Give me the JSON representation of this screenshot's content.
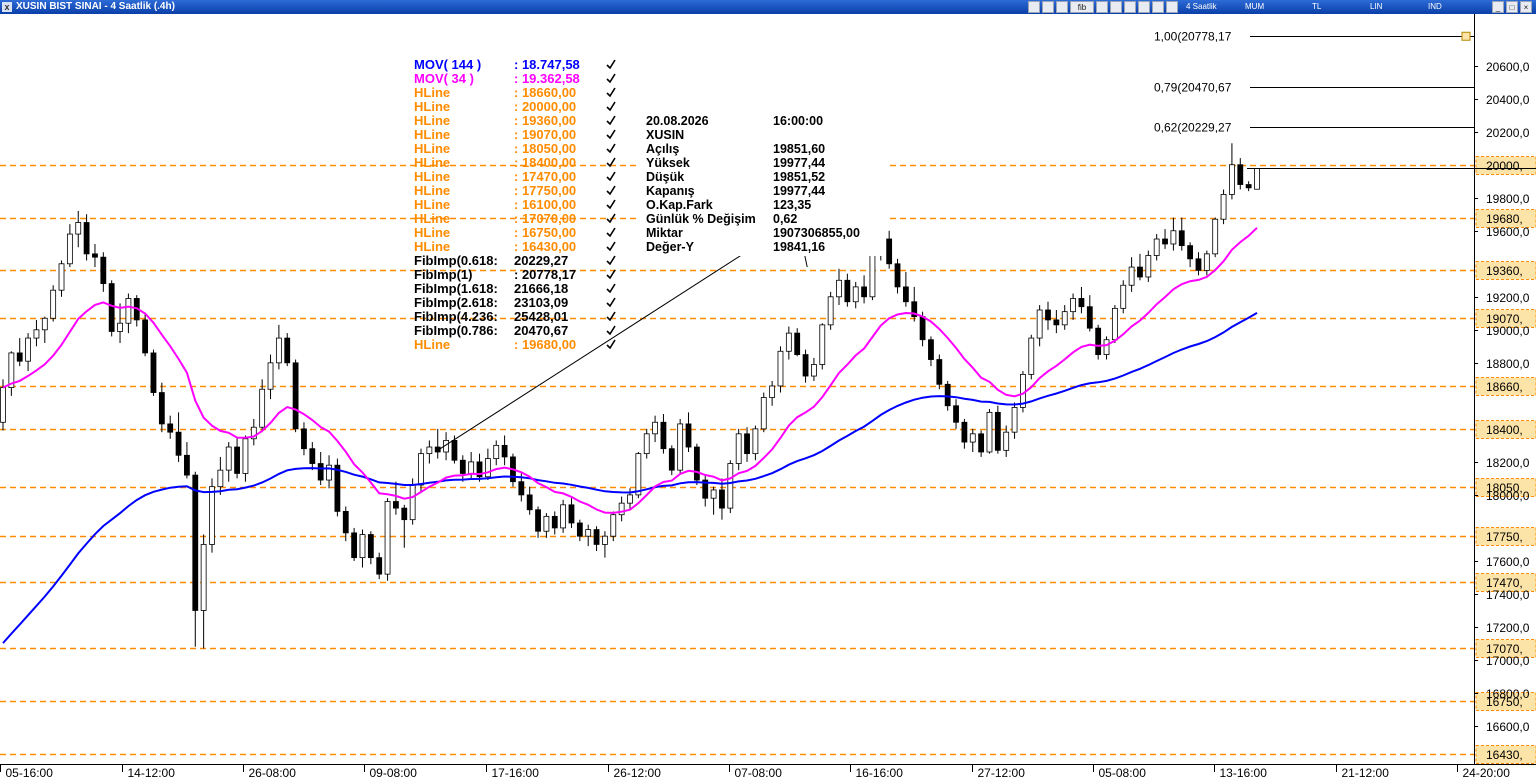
{
  "window": {
    "title": "XUSIN BIST SINAI - 4 Saatlik (.4h)",
    "toolbar": {
      "period": "4 Saatlik",
      "chart_style": "MUM",
      "currency": "TL",
      "scale": "LIN",
      "indicator": "IND",
      "fib_marker": "fib"
    }
  },
  "legend": [
    {
      "name": "MOV( 144 )",
      "value": ": 18.747,58",
      "color": "#0000ff"
    },
    {
      "name": "MOV( 34 )",
      "value": ": 19.362,58",
      "color": "#ff00ff"
    },
    {
      "name": "HLine",
      "value": ": 18660,00",
      "color": "#ff8c00"
    },
    {
      "name": "HLine",
      "value": ": 20000,00",
      "color": "#ff8c00"
    },
    {
      "name": "HLine",
      "value": ": 19360,00",
      "color": "#ff8c00"
    },
    {
      "name": "HLine",
      "value": ": 19070,00",
      "color": "#ff8c00"
    },
    {
      "name": "HLine",
      "value": ": 18050,00",
      "color": "#ff8c00"
    },
    {
      "name": "HLine",
      "value": ": 18400,00",
      "color": "#ff8c00"
    },
    {
      "name": "HLine",
      "value": ": 17470,00",
      "color": "#ff8c00"
    },
    {
      "name": "HLine",
      "value": ": 17750,00",
      "color": "#ff8c00"
    },
    {
      "name": "HLine",
      "value": ": 16100,00",
      "color": "#ff8c00"
    },
    {
      "name": "HLine",
      "value": ": 17070,00",
      "color": "#ff8c00"
    },
    {
      "name": "HLine",
      "value": ": 16750,00",
      "color": "#ff8c00"
    },
    {
      "name": "HLine",
      "value": ": 16430,00",
      "color": "#ff8c00"
    },
    {
      "name": "FibImp(0.618:",
      "value": " 20229,27",
      "color": "#000000"
    },
    {
      "name": "FibImp(1)",
      "value": ": 20778,17",
      "color": "#000000"
    },
    {
      "name": "FibImp(1.618:",
      "value": " 21666,18",
      "color": "#000000"
    },
    {
      "name": "FibImp(2.618:",
      "value": " 23103,09",
      "color": "#000000"
    },
    {
      "name": "FibImp(4.236:",
      "value": " 25428,01",
      "color": "#000000"
    },
    {
      "name": "FibImp(0.786:",
      "value": " 20470,67",
      "color": "#000000"
    },
    {
      "name": "HLine",
      "value": ": 19680,00",
      "color": "#ff8c00"
    }
  ],
  "info_panel": {
    "date": "20.08.2026",
    "time": "16:00:00",
    "symbol": "XUSIN",
    "rows": [
      {
        "label": "Açılış",
        "value": "19851,60"
      },
      {
        "label": "Yüksek",
        "value": "19977,44"
      },
      {
        "label": "Düşük",
        "value": "19851,52"
      },
      {
        "label": "Kapanış",
        "value": "19977,44"
      },
      {
        "label": "O.Kap.Fark",
        "value": "123,35"
      },
      {
        "label": "Günlük % Değişim",
        "value": "0,62"
      },
      {
        "label": "Miktar",
        "value": "1907306855,00"
      },
      {
        "label": "Değer-Y",
        "value": "19841,16"
      }
    ]
  },
  "colors": {
    "up_candle": "#ffffff",
    "down_candle": "#000000",
    "mov144": "#0000ff",
    "mov34": "#ff00ff",
    "hline": "#ff8c00",
    "price_badge": "#fce4a8"
  },
  "chart_data": {
    "type": "candlestick",
    "y_axis_ticks": [
      "20600,0",
      "20400,0",
      "20200,0",
      "19800,0",
      "19600,0",
      "19200,0",
      "19000,0",
      "18800,0",
      "18200,0",
      "18000,0",
      "17600,0",
      "17400,0",
      "17200,0",
      "17000,0",
      "16800,0",
      "16600,0"
    ],
    "y_axis_tick_values": [
      20600,
      20400,
      20200,
      19800,
      19600,
      19200,
      19000,
      18800,
      18200,
      18000,
      17600,
      17400,
      17200,
      17000,
      16800,
      16600
    ],
    "y_range": [
      16370,
      20913
    ],
    "x_axis_ticks": [
      "05-16:00",
      "14-12:00",
      "26-08:00",
      "09-08:00",
      "17-16:00",
      "26-12:00",
      "07-08:00",
      "16-16:00",
      "27-12:00",
      "05-08:00",
      "13-16:00",
      "21-12:00",
      "24-20:00"
    ],
    "hlines": [
      {
        "value": 20000,
        "label": "20000,"
      },
      {
        "value": 19680,
        "label": "19680,"
      },
      {
        "value": 19360,
        "label": "19360,"
      },
      {
        "value": 19070,
        "label": "19070,"
      },
      {
        "value": 18660,
        "label": "18660,"
      },
      {
        "value": 18400,
        "label": "18400,"
      },
      {
        "value": 18050,
        "label": "18050,"
      },
      {
        "value": 17750,
        "label": "17750,"
      },
      {
        "value": 17470,
        "label": "17470,"
      },
      {
        "value": 17070,
        "label": "17070,"
      },
      {
        "value": 16750,
        "label": "16750,"
      },
      {
        "value": 16430,
        "label": "16430,"
      }
    ],
    "fib_levels": [
      {
        "label": "1,00(20778,17",
        "value": 20778.17
      },
      {
        "label": "0,79(20470,67",
        "value": 20470.67
      },
      {
        "label": "0,62(20229,27",
        "value": 20229.27
      }
    ],
    "trendline": {
      "start": [
        52,
        18270
      ],
      "end": [
        95,
        19670
      ]
    },
    "last_close": 19977.44,
    "candles": [
      [
        18440,
        18700,
        18390,
        18650
      ],
      [
        18650,
        18870,
        18600,
        18860
      ],
      [
        18860,
        18950,
        18780,
        18810
      ],
      [
        18810,
        18980,
        18750,
        18950
      ],
      [
        18950,
        19060,
        18900,
        19000
      ],
      [
        19000,
        19080,
        18920,
        19070
      ],
      [
        19070,
        19270,
        19050,
        19240
      ],
      [
        19240,
        19420,
        19200,
        19400
      ],
      [
        19400,
        19640,
        19380,
        19580
      ],
      [
        19580,
        19720,
        19500,
        19650
      ],
      [
        19650,
        19700,
        19420,
        19460
      ],
      [
        19460,
        19520,
        19380,
        19440
      ],
      [
        19440,
        19470,
        19230,
        19280
      ],
      [
        19280,
        19300,
        18960,
        18990
      ],
      [
        18990,
        19160,
        18920,
        19040
      ],
      [
        19040,
        19220,
        18980,
        19190
      ],
      [
        19190,
        19210,
        19020,
        19060
      ],
      [
        19060,
        19100,
        18840,
        18860
      ],
      [
        18860,
        18880,
        18600,
        18620
      ],
      [
        18620,
        18680,
        18380,
        18430
      ],
      [
        18430,
        18480,
        18340,
        18380
      ],
      [
        18380,
        18500,
        18200,
        18240
      ],
      [
        18240,
        18320,
        18100,
        18120
      ],
      [
        18120,
        18140,
        17080,
        17300
      ],
      [
        17300,
        17760,
        17070,
        17700
      ],
      [
        17700,
        18100,
        17650,
        18050
      ],
      [
        18050,
        18230,
        18000,
        18150
      ],
      [
        18150,
        18320,
        18080,
        18290
      ],
      [
        18290,
        18350,
        18100,
        18130
      ],
      [
        18130,
        18360,
        18080,
        18340
      ],
      [
        18340,
        18460,
        18300,
        18410
      ],
      [
        18410,
        18700,
        18380,
        18640
      ],
      [
        18640,
        18850,
        18580,
        18800
      ],
      [
        18800,
        19030,
        18760,
        18950
      ],
      [
        18950,
        18980,
        18780,
        18800
      ],
      [
        18800,
        18820,
        18380,
        18400
      ],
      [
        18400,
        18440,
        18240,
        18280
      ],
      [
        18280,
        18320,
        18150,
        18190
      ],
      [
        18190,
        18260,
        18060,
        18090
      ],
      [
        18090,
        18240,
        18040,
        18180
      ],
      [
        18180,
        18220,
        17870,
        17900
      ],
      [
        17900,
        17930,
        17720,
        17770
      ],
      [
        17770,
        17800,
        17600,
        17620
      ],
      [
        17620,
        17790,
        17560,
        17760
      ],
      [
        17760,
        17780,
        17580,
        17620
      ],
      [
        17620,
        17650,
        17490,
        17520
      ],
      [
        17520,
        17980,
        17480,
        17960
      ],
      [
        17960,
        18080,
        17880,
        17920
      ],
      [
        17920,
        17940,
        17680,
        17850
      ],
      [
        17850,
        18100,
        17820,
        18060
      ],
      [
        18060,
        18280,
        18020,
        18250
      ],
      [
        18250,
        18330,
        18190,
        18290
      ],
      [
        18290,
        18400,
        18220,
        18260
      ],
      [
        18260,
        18380,
        18210,
        18330
      ],
      [
        18330,
        18360,
        18190,
        18210
      ],
      [
        18210,
        18240,
        18080,
        18130
      ],
      [
        18130,
        18260,
        18100,
        18200
      ],
      [
        18200,
        18250,
        18080,
        18110
      ],
      [
        18110,
        18280,
        18090,
        18220
      ],
      [
        18220,
        18330,
        18180,
        18300
      ],
      [
        18300,
        18360,
        18180,
        18230
      ],
      [
        18230,
        18250,
        18050,
        18080
      ],
      [
        18080,
        18130,
        17960,
        18000
      ],
      [
        18000,
        18050,
        17880,
        17910
      ],
      [
        17910,
        17930,
        17740,
        17780
      ],
      [
        17780,
        17890,
        17740,
        17870
      ],
      [
        17870,
        17900,
        17760,
        17800
      ],
      [
        17800,
        17970,
        17770,
        17940
      ],
      [
        17940,
        17980,
        17800,
        17830
      ],
      [
        17830,
        17850,
        17720,
        17750
      ],
      [
        17750,
        17820,
        17690,
        17790
      ],
      [
        17790,
        17810,
        17660,
        17700
      ],
      [
        17700,
        17780,
        17620,
        17750
      ],
      [
        17750,
        17900,
        17720,
        17880
      ],
      [
        17880,
        17990,
        17840,
        17950
      ],
      [
        17950,
        18040,
        17910,
        18000
      ],
      [
        18000,
        18260,
        17980,
        18250
      ],
      [
        18250,
        18400,
        18220,
        18370
      ],
      [
        18370,
        18480,
        18320,
        18440
      ],
      [
        18440,
        18490,
        18250,
        18280
      ],
      [
        18280,
        18300,
        18120,
        18150
      ],
      [
        18150,
        18460,
        18130,
        18430
      ],
      [
        18430,
        18500,
        18260,
        18290
      ],
      [
        18290,
        18310,
        18060,
        18090
      ],
      [
        18090,
        18120,
        17930,
        17980
      ],
      [
        17980,
        18050,
        17880,
        18030
      ],
      [
        18030,
        18100,
        17850,
        17920
      ],
      [
        17920,
        18210,
        17890,
        18190
      ],
      [
        18190,
        18400,
        18150,
        18370
      ],
      [
        18370,
        18410,
        18200,
        18250
      ],
      [
        18250,
        18420,
        18210,
        18400
      ],
      [
        18400,
        18620,
        18380,
        18590
      ],
      [
        18590,
        18690,
        18540,
        18660
      ],
      [
        18660,
        18900,
        18620,
        18870
      ],
      [
        18870,
        19020,
        18820,
        18980
      ],
      [
        18980,
        19010,
        18840,
        18850
      ],
      [
        18850,
        18880,
        18680,
        18720
      ],
      [
        18720,
        18830,
        18690,
        18790
      ],
      [
        18790,
        19040,
        18760,
        19030
      ],
      [
        19030,
        19230,
        19000,
        19200
      ],
      [
        19200,
        19370,
        19150,
        19300
      ],
      [
        19300,
        19340,
        19140,
        19170
      ],
      [
        19170,
        19290,
        19130,
        19260
      ],
      [
        19260,
        19330,
        19160,
        19200
      ],
      [
        19200,
        19510,
        19180,
        19480
      ],
      [
        19480,
        19590,
        19420,
        19550
      ],
      [
        19550,
        19600,
        19370,
        19400
      ],
      [
        19400,
        19430,
        19220,
        19260
      ],
      [
        19260,
        19350,
        19140,
        19170
      ],
      [
        19170,
        19260,
        19050,
        19080
      ],
      [
        19080,
        19110,
        18900,
        18940
      ],
      [
        18940,
        18960,
        18780,
        18820
      ],
      [
        18820,
        18850,
        18640,
        18670
      ],
      [
        18670,
        18690,
        18510,
        18540
      ],
      [
        18540,
        18580,
        18400,
        18440
      ],
      [
        18440,
        18460,
        18280,
        18320
      ],
      [
        18320,
        18400,
        18260,
        18370
      ],
      [
        18370,
        18390,
        18230,
        18260
      ],
      [
        18260,
        18520,
        18250,
        18500
      ],
      [
        18500,
        18540,
        18250,
        18270
      ],
      [
        18270,
        18420,
        18230,
        18380
      ],
      [
        18380,
        18560,
        18340,
        18530
      ],
      [
        18530,
        18750,
        18500,
        18730
      ],
      [
        18730,
        18970,
        18700,
        18950
      ],
      [
        18950,
        19150,
        18900,
        19120
      ],
      [
        19120,
        19170,
        19000,
        19060
      ],
      [
        19060,
        19120,
        18980,
        19030
      ],
      [
        19030,
        19150,
        19000,
        19110
      ],
      [
        19110,
        19220,
        19060,
        19190
      ],
      [
        19190,
        19260,
        19100,
        19140
      ],
      [
        19140,
        19210,
        18990,
        19010
      ],
      [
        19010,
        19030,
        18820,
        18850
      ],
      [
        18850,
        18960,
        18820,
        18940
      ],
      [
        18940,
        19150,
        18920,
        19130
      ],
      [
        19130,
        19300,
        19100,
        19270
      ],
      [
        19270,
        19440,
        19230,
        19380
      ],
      [
        19380,
        19460,
        19300,
        19320
      ],
      [
        19320,
        19480,
        19290,
        19450
      ],
      [
        19450,
        19580,
        19420,
        19550
      ],
      [
        19550,
        19610,
        19490,
        19520
      ],
      [
        19520,
        19680,
        19480,
        19600
      ],
      [
        19600,
        19680,
        19480,
        19510
      ],
      [
        19510,
        19530,
        19380,
        19430
      ],
      [
        19430,
        19470,
        19330,
        19360
      ],
      [
        19360,
        19480,
        19330,
        19460
      ],
      [
        19460,
        19680,
        19440,
        19670
      ],
      [
        19670,
        19850,
        19640,
        19820
      ],
      [
        19820,
        20130,
        19790,
        20000
      ],
      [
        20000,
        20040,
        19850,
        19880
      ],
      [
        19880,
        19900,
        19840,
        19860
      ],
      [
        19851.6,
        19977.44,
        19851.52,
        19977.44
      ]
    ]
  }
}
